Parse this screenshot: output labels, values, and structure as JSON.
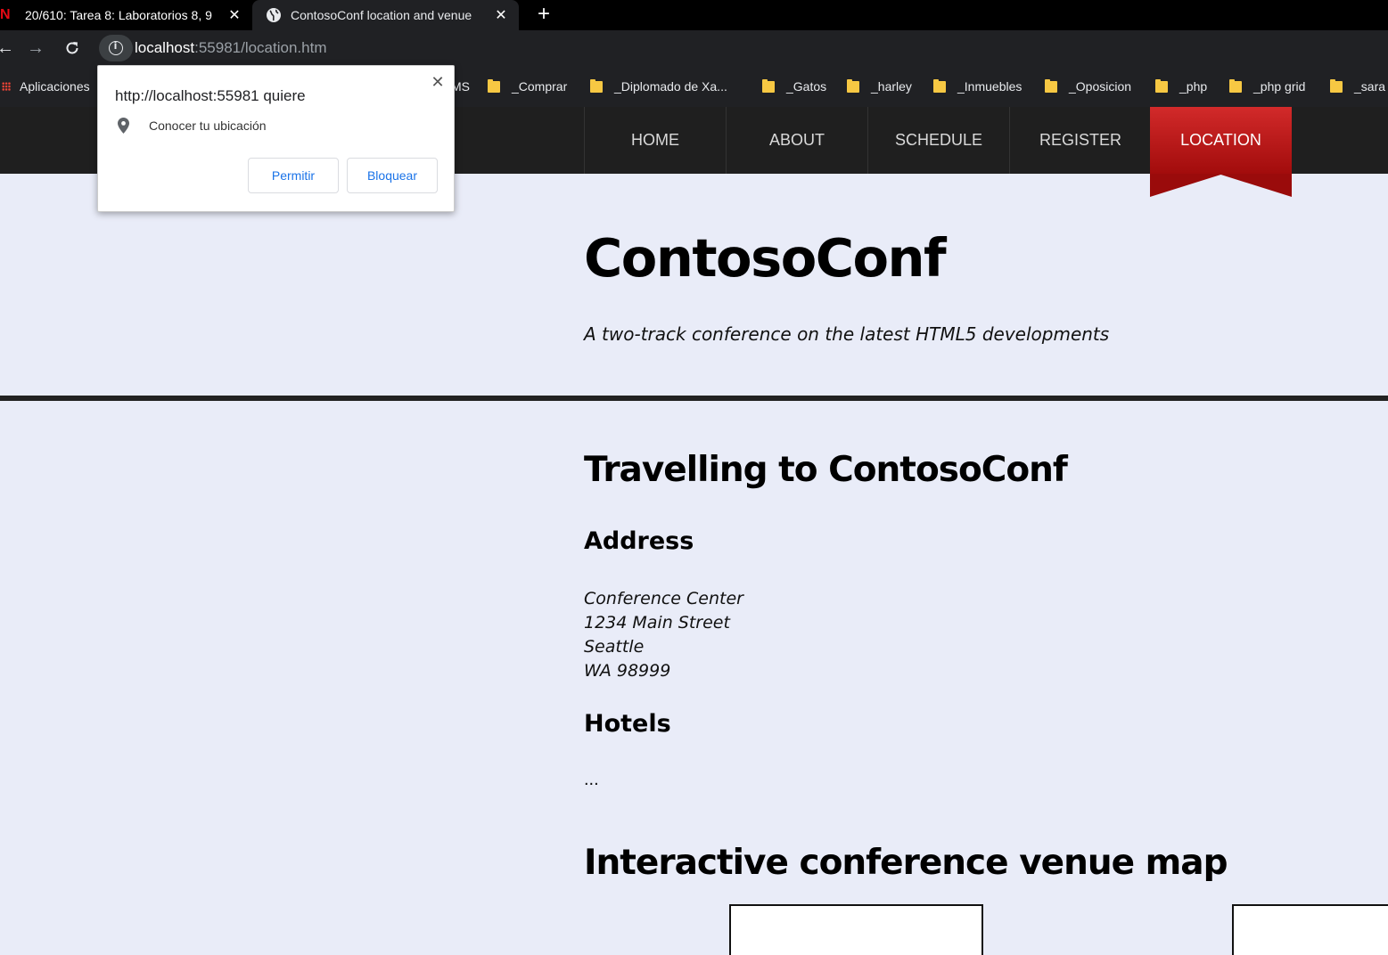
{
  "browser": {
    "tabs": [
      {
        "title": "20/610: Tarea 8: Laboratorios 8, 9",
        "favicon": "netflix-n-icon",
        "active": false
      },
      {
        "title": "ContosoConf location and venue",
        "favicon": "globe-icon",
        "active": true
      }
    ],
    "url_host": "localhost",
    "url_rest": ":55981/location.htm",
    "bookmarks": [
      "Aplicaciones",
      "MS",
      "_Comprar",
      "_Diplomado de Xa...",
      "_Gatos",
      "_harley",
      "_Inmuebles",
      "_Oposicion",
      "_php",
      "_php grid",
      "_sara"
    ]
  },
  "permission_popup": {
    "title": "http://localhost:55981 quiere",
    "request": "Conocer tu ubicación",
    "allow_label": "Permitir",
    "block_label": "Bloquear"
  },
  "site_nav": {
    "items": [
      "HOME",
      "ABOUT",
      "SCHEDULE",
      "REGISTER",
      "LOCATION"
    ],
    "active": "LOCATION"
  },
  "header": {
    "title": "ContosoConf",
    "tagline": "A two-track conference on the latest HTML5 developments"
  },
  "main": {
    "travel_heading": "Travelling to ContosoConf",
    "address_heading": "Address",
    "address_lines": [
      "Conference Center",
      "1234 Main Street",
      "Seattle",
      "WA 98999"
    ],
    "hotels_heading": "Hotels",
    "hotels_text": "...",
    "map_heading": "Interactive conference venue map"
  },
  "colors": {
    "page_bg": "#e9ecf8",
    "nav_bg": "#1f1f1f",
    "active_tab_red": "#b01818",
    "link_blue": "#1a73e8"
  }
}
